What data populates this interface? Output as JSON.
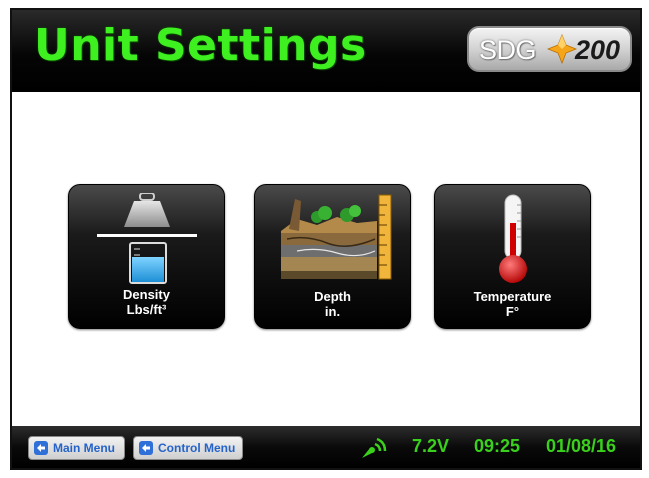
{
  "header": {
    "title": "Unit Settings",
    "logo": {
      "brand": "SDG",
      "model": "200"
    }
  },
  "tiles": [
    {
      "line1": "Density",
      "line2": "Lbs/ft³",
      "icon": "weight-beaker-icon"
    },
    {
      "line1": "Depth",
      "line2": "in.",
      "icon": "soil-layers-ruler-icon"
    },
    {
      "line1": "Temperature",
      "line2": "F°",
      "icon": "thermometer-icon"
    }
  ],
  "footer": {
    "main_menu_label": "Main Menu",
    "control_menu_label": "Control Menu",
    "voltage": "7.2V",
    "time": "09:25",
    "date": "01/08/16",
    "signal_icon": "satellite-signal-icon"
  },
  "colors": {
    "title_green": "#3ef01f",
    "status_green": "#3ad11c",
    "menu_text_blue": "#2563c9",
    "logo_star": "#f5a51a"
  }
}
